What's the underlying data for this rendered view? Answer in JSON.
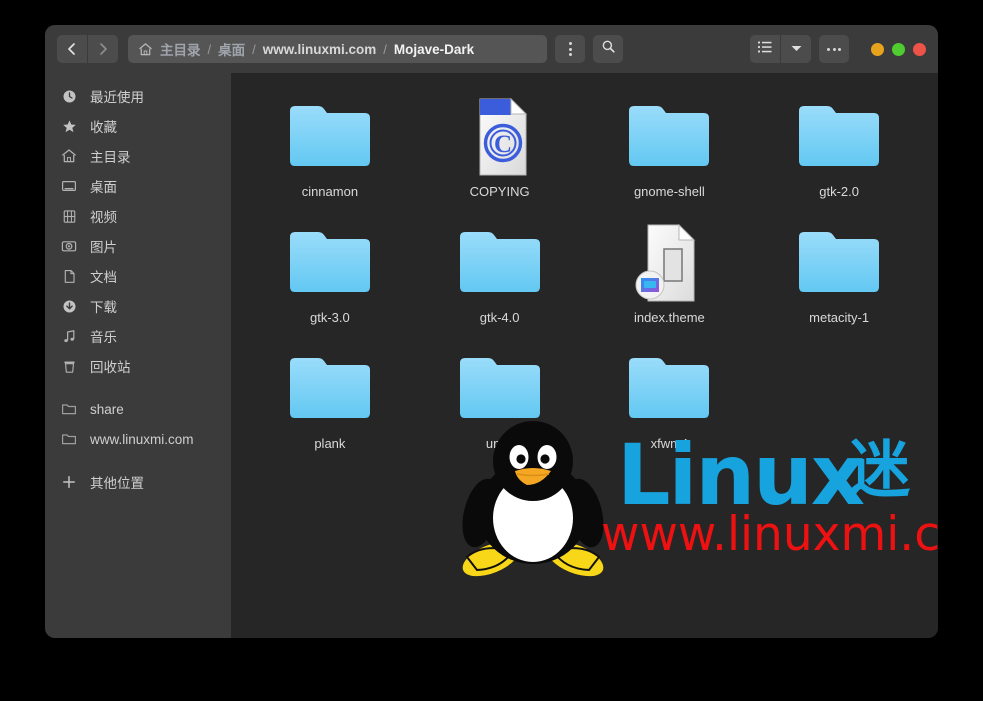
{
  "window": {
    "title": "Mojave-Dark",
    "colors": {
      "titlebar_bg": "#3b3b3b",
      "sidebar_bg": "#3b3b3b",
      "content_bg": "#262626",
      "folder_blue": "#7dd3f7",
      "accent_copyright": "#3b5ddb"
    }
  },
  "toolbar": {
    "back_label": "Back",
    "forward_label": "Forward",
    "menu_label": "Menu",
    "search_label": "Search",
    "list_view_label": "List View",
    "view_options_label": "View Options",
    "more_label": "More Options",
    "back_icon": "chevron-left-icon",
    "forward_icon": "chevron-right-icon",
    "menu_icon": "dots-vertical-icon",
    "search_icon": "search-icon",
    "list_icon": "list-view-icon",
    "chevron_icon": "chevron-down-icon",
    "more_icon": "dots-horizontal-icon"
  },
  "window_controls": [
    {
      "name": "minimize-button",
      "color": "#e8a31c"
    },
    {
      "name": "maximize-button",
      "color": "#4fcc2f"
    },
    {
      "name": "close-button",
      "color": "#ee5349"
    }
  ],
  "breadcrumb": {
    "home_icon": "home-icon",
    "separator": "/",
    "items": [
      {
        "label": "主目录",
        "current": false
      },
      {
        "label": "桌面",
        "current": false
      },
      {
        "label": "www.linuxmi.com",
        "current": false
      },
      {
        "label": "Mojave-Dark",
        "current": true
      }
    ]
  },
  "sidebar": {
    "items": [
      {
        "label": "最近使用",
        "icon": "clock-icon"
      },
      {
        "label": "收藏",
        "icon": "star-icon"
      },
      {
        "label": "主目录",
        "icon": "home-icon"
      },
      {
        "label": "桌面",
        "icon": "desktop-icon"
      },
      {
        "label": "视频",
        "icon": "video-icon"
      },
      {
        "label": "图片",
        "icon": "camera-icon"
      },
      {
        "label": "文档",
        "icon": "document-icon"
      },
      {
        "label": "下载",
        "icon": "download-icon"
      },
      {
        "label": "音乐",
        "icon": "music-icon"
      },
      {
        "label": "回收站",
        "icon": "trash-icon"
      }
    ],
    "bookmarks": [
      {
        "label": "share",
        "icon": "folder-outline-icon"
      },
      {
        "label": "www.linuxmi.com",
        "icon": "folder-outline-icon"
      }
    ],
    "other": {
      "label": "其他位置",
      "icon": "plus-icon"
    }
  },
  "files": [
    {
      "name": "cinnamon",
      "type": "folder"
    },
    {
      "name": "COPYING",
      "type": "copying-document"
    },
    {
      "name": "gnome-shell",
      "type": "folder"
    },
    {
      "name": "gtk-2.0",
      "type": "folder"
    },
    {
      "name": "gtk-3.0",
      "type": "folder"
    },
    {
      "name": "gtk-4.0",
      "type": "folder"
    },
    {
      "name": "index.theme",
      "type": "theme-document"
    },
    {
      "name": "metacity-1",
      "type": "folder"
    },
    {
      "name": "plank",
      "type": "folder"
    },
    {
      "name": "unity",
      "type": "folder"
    },
    {
      "name": "xfwm4",
      "type": "folder"
    }
  ],
  "watermark": {
    "brand": "Linux",
    "brand_suffix": "迷",
    "url": "www.linuxmi.com",
    "mascot": "tux-penguin-icon",
    "brand_color": "#17a3de",
    "url_color": "#ee1111"
  }
}
